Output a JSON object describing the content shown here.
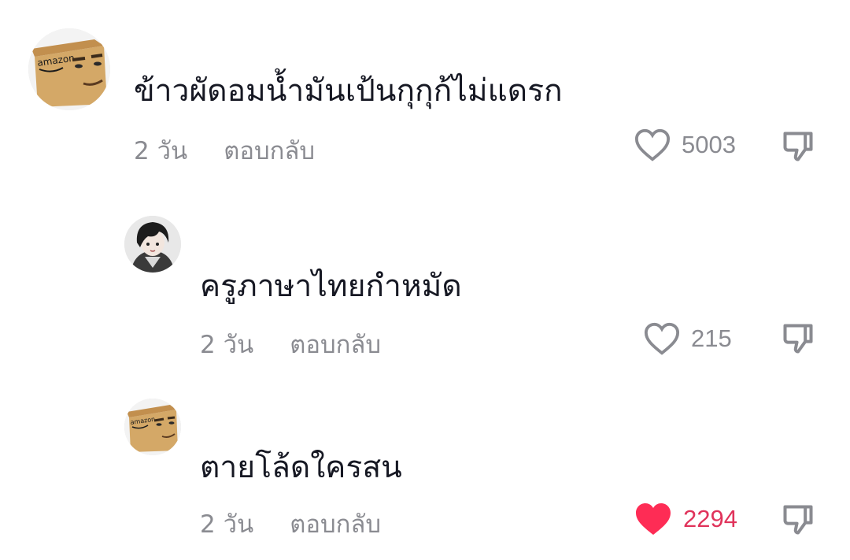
{
  "comments": [
    {
      "avatar": "amazon-box-face-avatar",
      "text": "ข้าวผัดอมน้ำมันเป้นกุกุก้ไม่แดรก",
      "time": "2 วัน",
      "reply_label": "ตอบกลับ",
      "likes": "5003",
      "liked": false
    },
    {
      "avatar": "anime-character-avatar",
      "text": "ครูภาษาไทยกำหมัด",
      "time": "2 วัน",
      "reply_label": "ตอบกลับ",
      "likes": "215",
      "liked": false
    },
    {
      "avatar": "amazon-box-face-avatar",
      "text": "ตายโล้ดใครสน",
      "time": "2 วัน",
      "reply_label": "ตอบกลับ",
      "likes": "2294",
      "liked": true
    }
  ],
  "icons": {
    "like": "heart-icon",
    "dislike": "thumbs-down-icon"
  },
  "colors": {
    "liked_heart": "#fe2c55",
    "meta_text": "#8a8b91",
    "comment_text": "#161823"
  }
}
